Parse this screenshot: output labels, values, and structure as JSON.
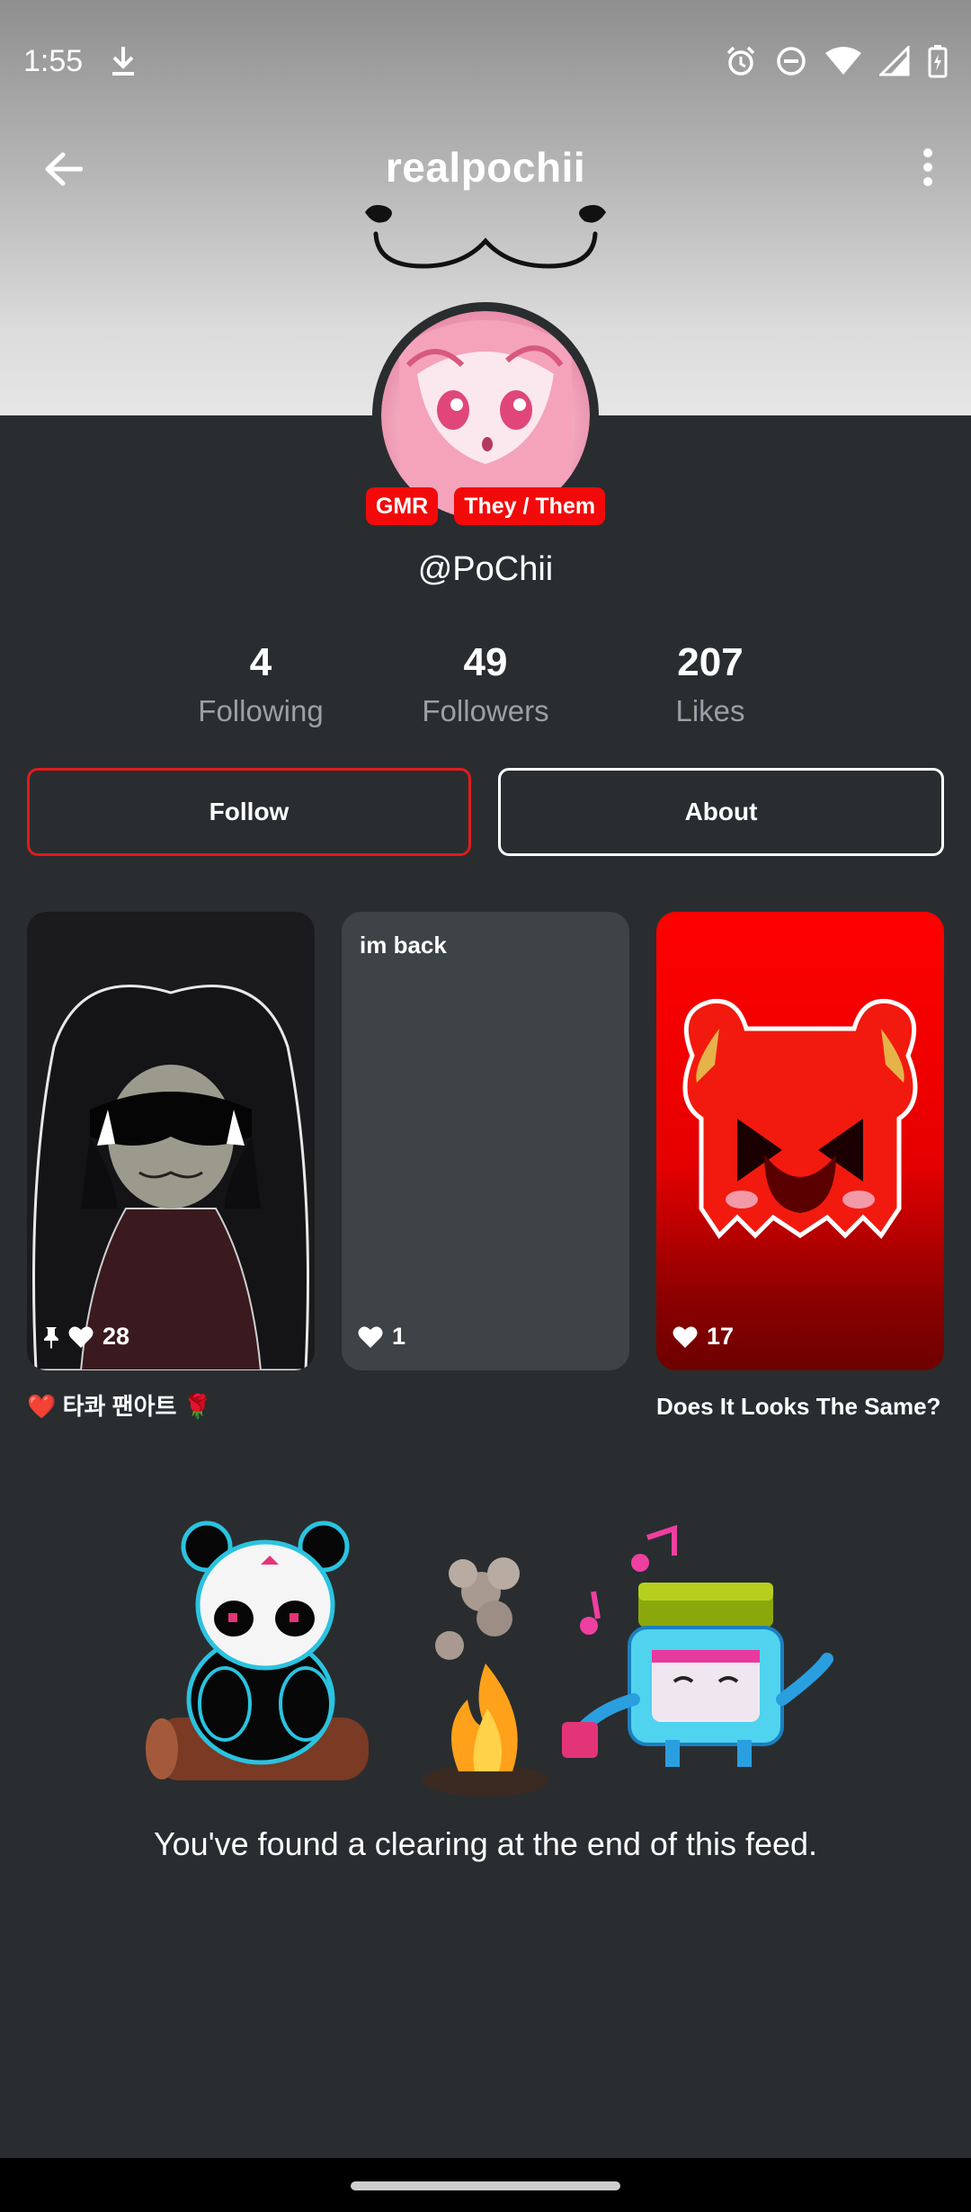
{
  "status_bar": {
    "time": "1:55",
    "icons": [
      "download-icon",
      "alarm-icon",
      "do-not-disturb-icon",
      "wifi-icon",
      "signal-icon",
      "battery-charging-icon"
    ]
  },
  "header": {
    "title": "realpochii",
    "back_icon": "arrow-left-icon",
    "menu_icon": "more-vertical-icon"
  },
  "profile": {
    "tags": [
      "GMR",
      "They / Them"
    ],
    "handle": "@PoChii",
    "stats": [
      {
        "value": "4",
        "label": "Following"
      },
      {
        "value": "49",
        "label": "Followers"
      },
      {
        "value": "207",
        "label": "Likes"
      }
    ]
  },
  "actions": {
    "follow_label": "Follow",
    "about_label": "About"
  },
  "posts": [
    {
      "top_text": "",
      "pinned": true,
      "likes": "28",
      "caption": "❤️ 타콰 팬아트 🌹"
    },
    {
      "top_text": "im back",
      "pinned": false,
      "likes": "1",
      "caption": ""
    },
    {
      "top_text": "",
      "pinned": false,
      "likes": "17",
      "caption": "Does It Looks The Same?"
    }
  ],
  "feed_end": {
    "message": "You've found a clearing at the end of this feed."
  },
  "colors": {
    "background": "#292d30",
    "accent_red": "#f20a0a",
    "follow_border": "#e01b1b",
    "muted_text": "#9aa0a5"
  }
}
